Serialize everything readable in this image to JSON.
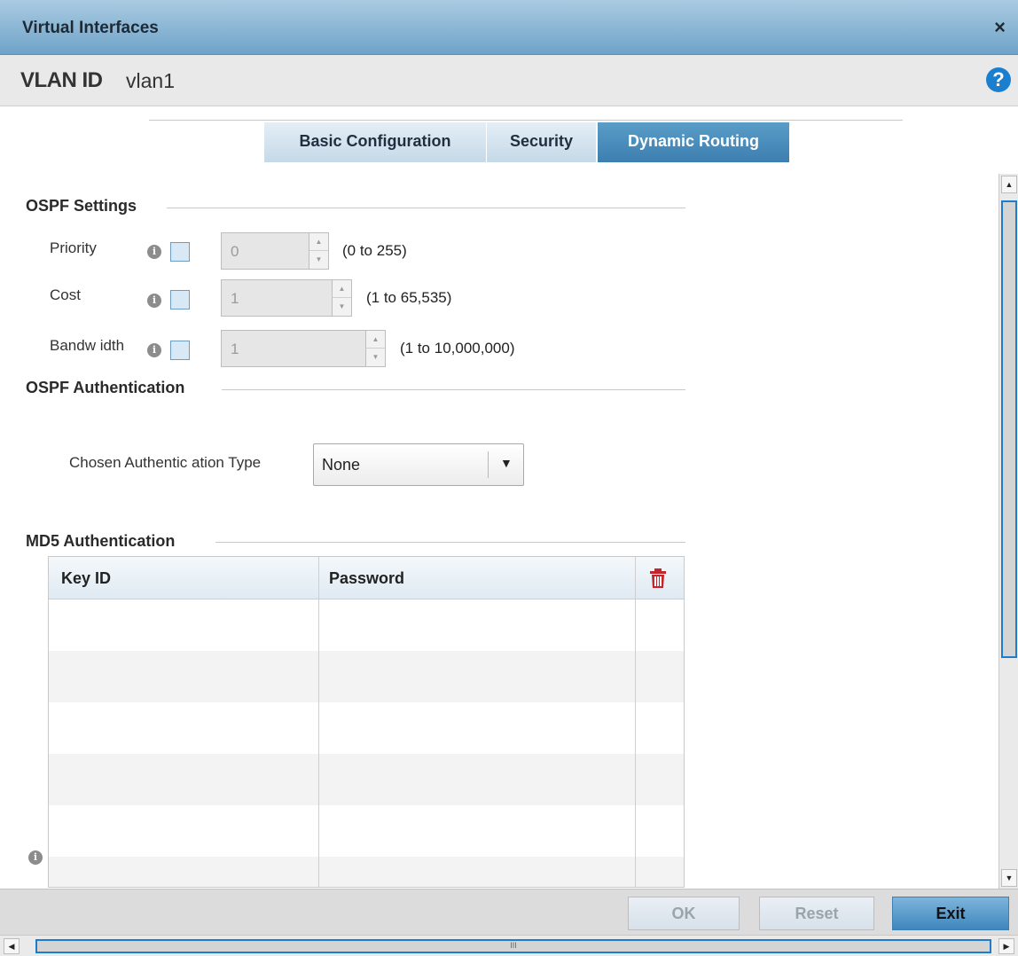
{
  "window": {
    "title": "Virtual Interfaces",
    "close_glyph": "×"
  },
  "header": {
    "vlan_label": "VLAN ID",
    "vlan_value": "vlan1",
    "help_glyph": "?"
  },
  "tabs": [
    {
      "label": "Basic Configuration",
      "active": false
    },
    {
      "label": "Security",
      "active": false
    },
    {
      "label": "Dynamic Routing",
      "active": true
    }
  ],
  "ospf_settings": {
    "heading": "OSPF Settings",
    "fields": [
      {
        "label": "Priority",
        "value": "0",
        "range": "(0 to 255)",
        "checked": false
      },
      {
        "label": "Cost",
        "value": "1",
        "range": "(1 to 65,535)",
        "checked": false
      },
      {
        "label": "Bandw idth",
        "value": "1",
        "range": "(1 to 10,000,000)",
        "checked": false
      }
    ]
  },
  "ospf_auth": {
    "heading": "OSPF Authentication",
    "type_label": "Chosen Authentic ation Type",
    "type_value": "None"
  },
  "md5": {
    "heading": "MD5 Authentication",
    "columns": [
      "Key ID",
      "Password"
    ]
  },
  "footer": {
    "ok": "OK",
    "reset": "Reset",
    "exit": "Exit"
  },
  "icons": {
    "info": "info-icon",
    "trash": "trash-icon",
    "close": "close-icon",
    "help": "help-icon"
  },
  "colors": {
    "accent": "#3c7fb0",
    "title_bar": "#8bb8d8",
    "trash": "#c0262b",
    "help": "#1b7fcf"
  },
  "glyphs": {
    "spin_up": "▲",
    "spin_down": "▼",
    "dropdown": "▼",
    "info": "i",
    "scroll_thumb": "III"
  }
}
